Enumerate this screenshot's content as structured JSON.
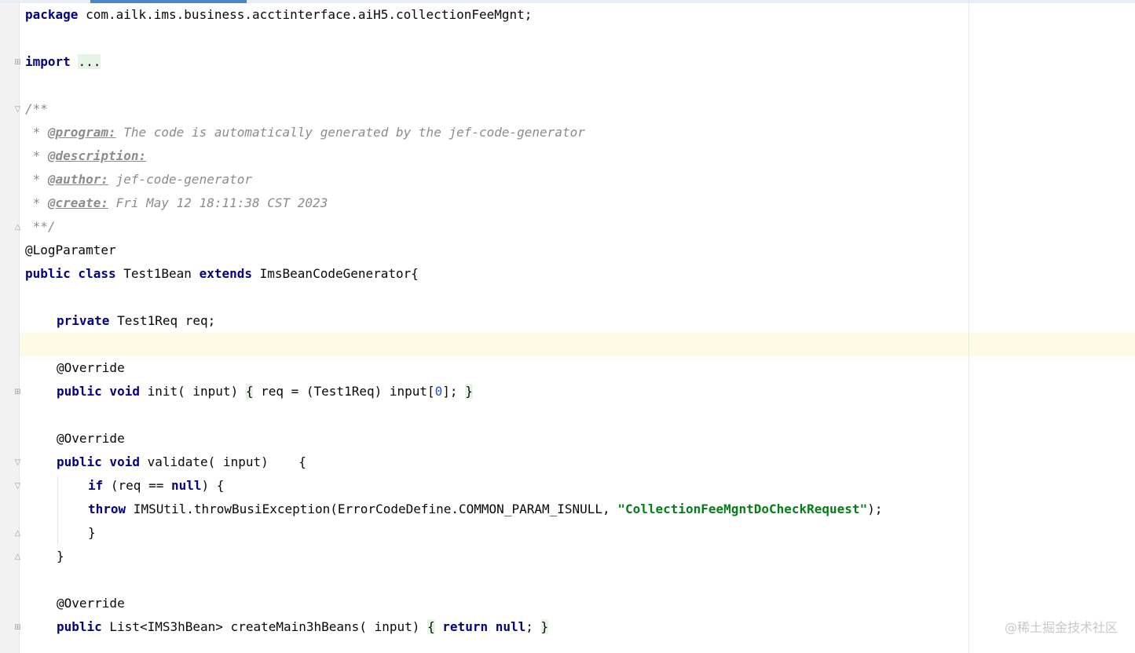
{
  "editor": {
    "lines": {
      "l1": {
        "kw": "package",
        "rest": " com.ailk.ims.business.acctinterface.aiH5.collectionFeeMgnt;"
      },
      "l3": {
        "kw": "import",
        "fold": "..."
      },
      "l5": "/**",
      "l6": {
        "prefix": " * ",
        "tag": "@program:",
        "text": " The code is automatically generated by the jef-code-generator"
      },
      "l7": {
        "prefix": " * ",
        "tag": "@description:"
      },
      "l8": {
        "prefix": " * ",
        "tag": "@author:",
        "text": " jef-code-generator"
      },
      "l9": {
        "prefix": " * ",
        "tag": "@create:",
        "text": " Fri May 12 18:11:38 CST 2023"
      },
      "l10": " **/",
      "l11": "@LogParamter",
      "l12": {
        "kw1": "public class",
        "name": " Test1Bean ",
        "kw2": "extends",
        "rest": " ImsBeanCodeGenerator{"
      },
      "l14": {
        "kw": "private",
        "rest": " Test1Req req;"
      },
      "l16": "@Override",
      "l17": {
        "kw": "public void",
        "a": " init( input) ",
        "open": "{",
        "b": " req = (Test1Req) input[",
        "num": "0",
        "c": "]; ",
        "close": "}"
      },
      "l19": "@Override",
      "l20": {
        "kw": "public void",
        "rest": " validate( input)    {"
      },
      "l21": {
        "kw": "if",
        "a": " (req == ",
        "kw2": "null",
        "b": ") {"
      },
      "l22": {
        "kw": "throw",
        "a": " IMSUtil.throwBusiException(ErrorCodeDefine.COMMON_PARAM_ISNULL, ",
        "str": "\"CollectionFeeMgntDoCheckRequest\"",
        "b": ");"
      },
      "l23": "}",
      "l24": "}",
      "l26": "@Override",
      "l27": {
        "kw": "public",
        "a": " List<IMS3hBean> createMain3hBeans( input) ",
        "open": "{",
        "kw2": " return",
        "kw3": " null",
        "b": "; ",
        "close": "}"
      }
    }
  },
  "watermark": "@稀土掘金技术社区",
  "colors": {
    "keyword": "#000080",
    "string": "#067d17",
    "comment": "#8c8c8c",
    "number": "#1750eb",
    "current_line": "#fffae3"
  }
}
